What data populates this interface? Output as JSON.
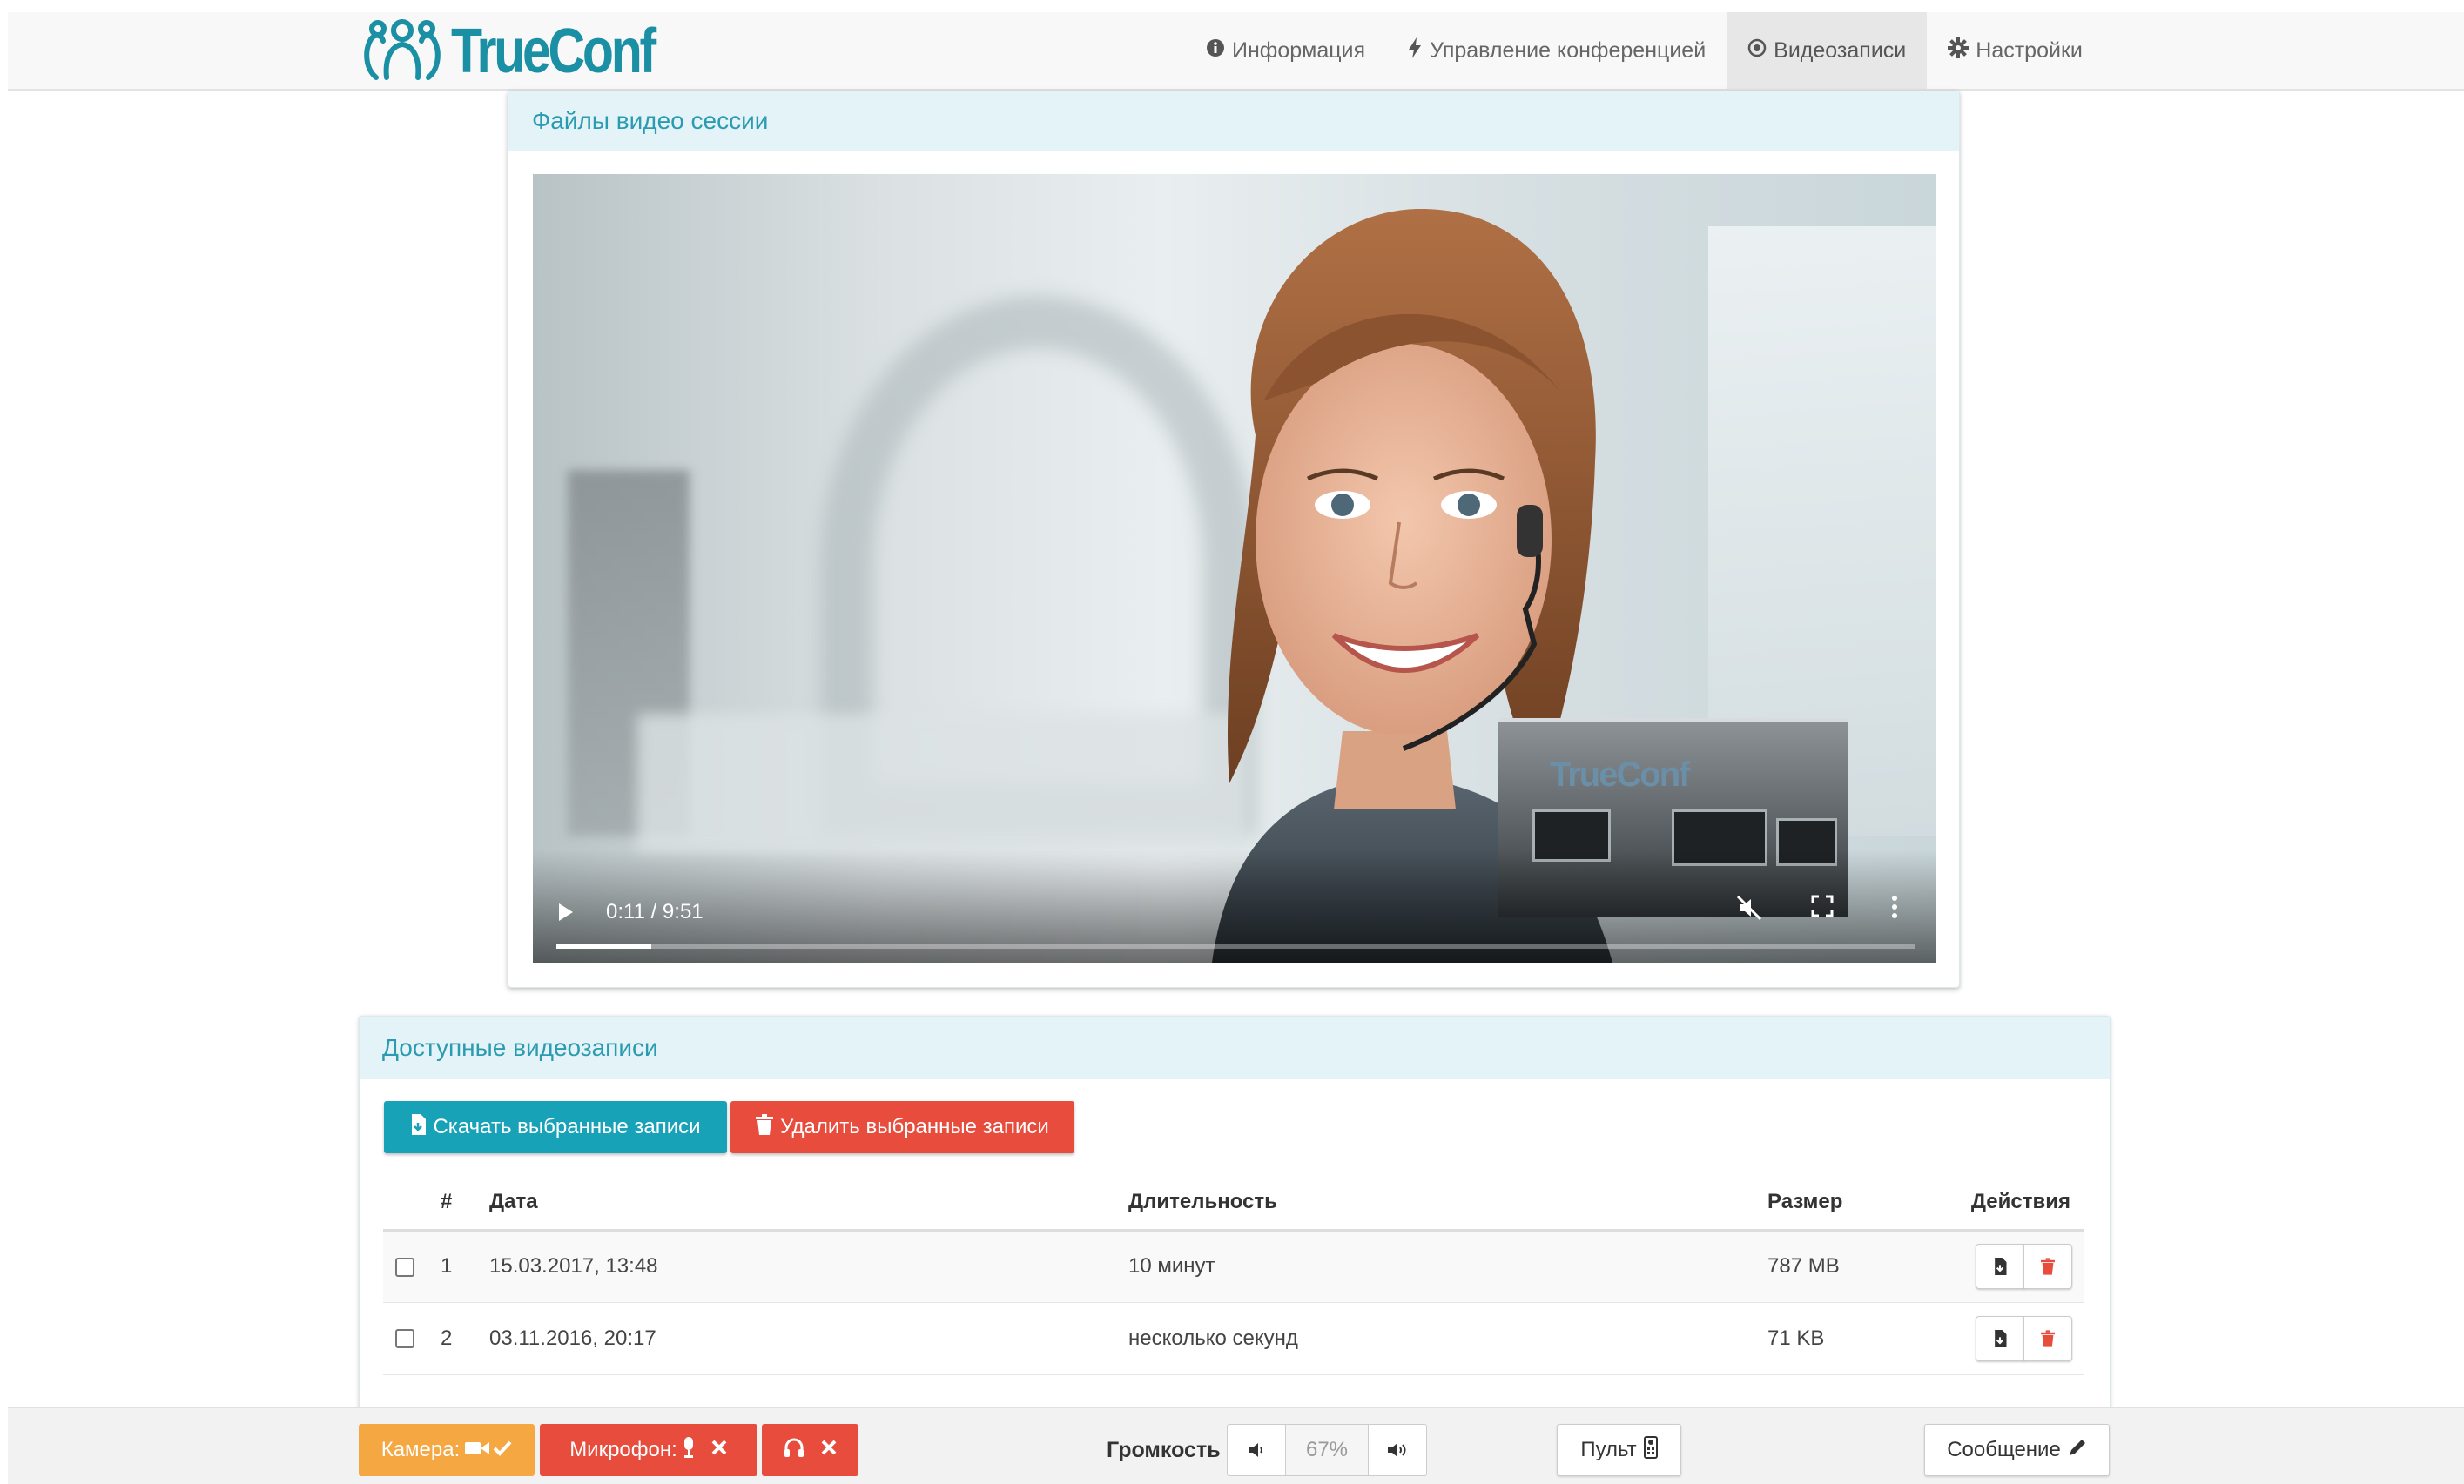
{
  "brand": {
    "name": "TrueConf",
    "color": "#1b8fa3"
  },
  "nav": {
    "items": [
      {
        "label": "Информация",
        "icon": "info-circle-icon",
        "active": false
      },
      {
        "label": "Управление конференцией",
        "icon": "bolt-icon",
        "active": false
      },
      {
        "label": "Видеозаписи",
        "icon": "record-circle-icon",
        "active": true
      },
      {
        "label": "Настройки",
        "icon": "gear-icon",
        "active": false
      }
    ]
  },
  "video_panel": {
    "title": "Файлы видео сессии",
    "player": {
      "time": "0:11 / 9:51",
      "progress_percent": 7,
      "muted": true
    }
  },
  "recordings": {
    "title": "Доступные видеозаписи",
    "download_label": "Скачать выбранные записи",
    "delete_label": "Удалить выбранные записи",
    "columns": [
      "#",
      "Дата",
      "Длительность",
      "Размер",
      "Действия"
    ],
    "rows": [
      {
        "num": "1",
        "date": "15.03.2017, 13:48",
        "duration": "10 минут",
        "size": "787 MB"
      },
      {
        "num": "2",
        "date": "03.11.2016, 20:17",
        "duration": "несколько секунд",
        "size": "71 KB"
      }
    ]
  },
  "toolbar": {
    "camera_label": "Камера:",
    "mic_label": "Микрофон:",
    "volume_label": "Громкость",
    "volume_value": "67%",
    "remote_label": "Пульт",
    "message_label": "Сообщение"
  },
  "colors": {
    "teal": "#17a2b8",
    "red": "#e74c3c",
    "orange": "#f5a742",
    "heading_bg": "#e3f3f7"
  }
}
